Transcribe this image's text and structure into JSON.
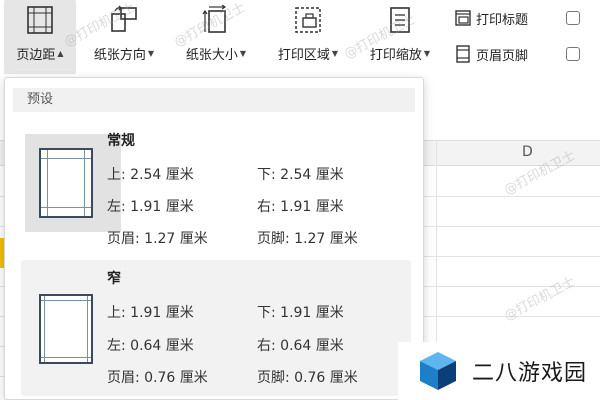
{
  "toolbar": {
    "buttons": [
      {
        "label": "页边距",
        "icon": "margins-icon",
        "active": true
      },
      {
        "label": "纸张方向",
        "icon": "paper-orientation-icon"
      },
      {
        "label": "纸张大小",
        "icon": "paper-size-icon"
      },
      {
        "label": "打印区域",
        "icon": "print-area-icon"
      },
      {
        "label": "打印缩放",
        "icon": "print-scale-icon"
      }
    ],
    "print_titles": "打印标题",
    "header_footer": "页眉页脚"
  },
  "sheet": {
    "column_d": "D",
    "watermark": "@打印机卫士",
    "row_highlight_color": "#f2c200"
  },
  "dropdown": {
    "section": "预设",
    "presets": [
      {
        "name": "常规",
        "top": "上: 2.54 厘米",
        "bottom": "下: 2.54 厘米",
        "left": "左: 1.91 厘米",
        "right": "右: 1.91 厘米",
        "header": "页眉: 1.27 厘米",
        "footer": "页脚: 1.27 厘米"
      },
      {
        "name": "窄",
        "top": "上: 1.91 厘米",
        "bottom": "下: 1.91 厘米",
        "left": "左: 0.64 厘米",
        "right": "右: 0.64 厘米",
        "header": "页眉: 0.76 厘米",
        "footer": "页脚: 0.76 厘米"
      }
    ]
  },
  "logo": {
    "text": "二八游戏园",
    "colors": [
      "#1d7fc8",
      "#0b3f7a",
      "#5fb6ee"
    ]
  }
}
